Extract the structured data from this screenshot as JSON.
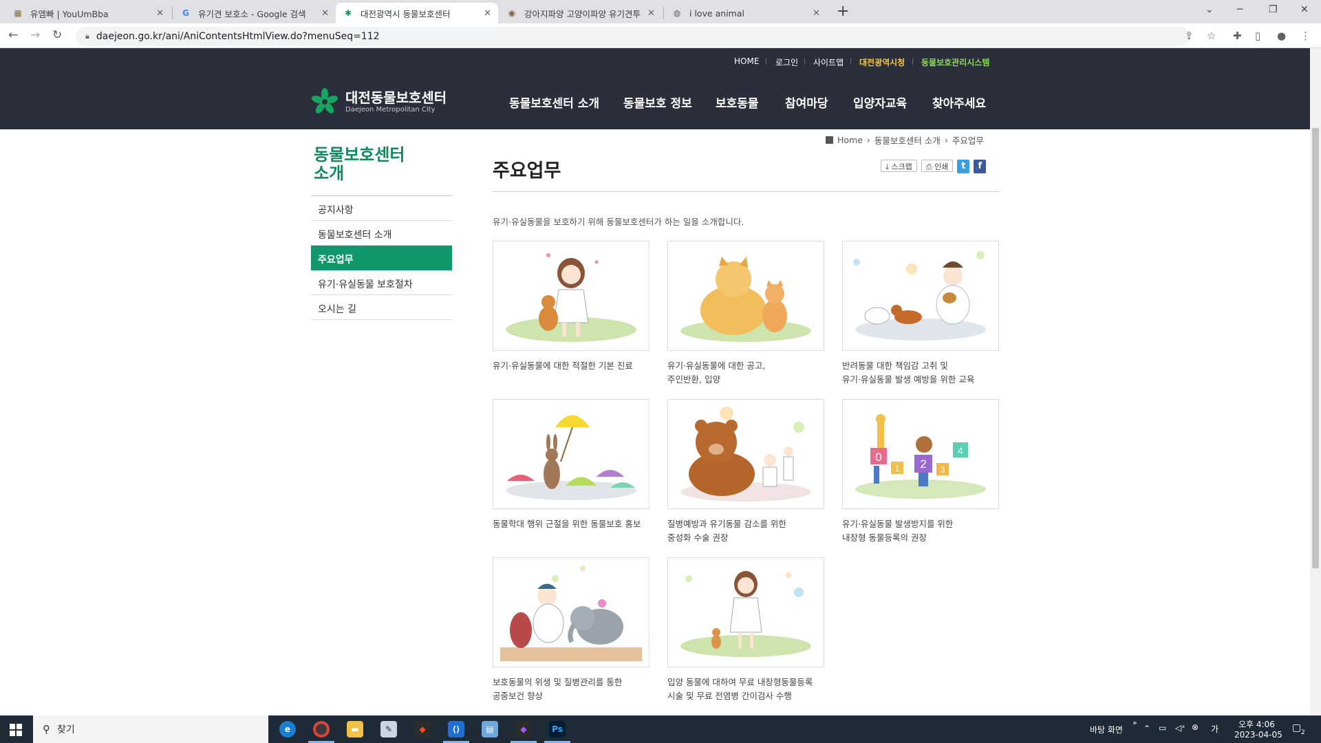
{
  "browser": {
    "tabs": [
      {
        "title": "유엠빠 | YouUmBba",
        "icon": "youumbba-icon"
      },
      {
        "title": "유기견 보호소 - Google 검색",
        "icon": "google-icon"
      },
      {
        "title": "대전광역시 동물보호센터",
        "icon": "daejeon-icon"
      },
      {
        "title": "강아지파양 고양이파양 유기견투",
        "icon": "dog-photo-icon"
      },
      {
        "title": "i love animal",
        "icon": "globe-icon"
      }
    ],
    "url": "daejeon.go.kr/ani/AniContentsHtmlView.do?menuSeq=112"
  },
  "site": {
    "top_links": [
      "HOME",
      "로그인",
      "사이트맵",
      "대전광역시청",
      "동물보호관리시스템"
    ],
    "logo_title": "대전동물보호센터",
    "logo_sub": "Daejeon Metropolitan City",
    "menu": [
      "동물보호센터 소개",
      "동물보호 정보",
      "보호동물",
      "참여마당",
      "입양자교육",
      "찾아주세요"
    ],
    "accent_color": "#11976a",
    "header_color": "#2b2f3c"
  },
  "breadcrumb": {
    "home": "Home",
    "sep": "›",
    "level1": "동물보호센터 소개",
    "level2": "주요업무"
  },
  "sidebar": {
    "title": "동물보호센터\n소개",
    "items": [
      {
        "label": "공지사항",
        "active": false
      },
      {
        "label": "동물보호센터 소개",
        "active": false
      },
      {
        "label": "주요업무",
        "active": true
      },
      {
        "label": "유기·유실동물 보호절차",
        "active": false
      },
      {
        "label": "오시는 길",
        "active": false
      }
    ]
  },
  "content": {
    "title": "주요업무",
    "tools": {
      "scrap": "스크랩",
      "print": "인쇄",
      "twitter": "t",
      "facebook": "f"
    },
    "intro": "유기·유실동물을 보호하기 위해 동물보호센터가 하는 일을 소개합니다.",
    "cards": [
      "유기·유실동물에 대한 적절한 기본 진료",
      "유기·유실동물에 대한 공고,\n주인반환, 입양",
      "반려동물 대한 책임감 고취 및\n유기·유실동물 발생 예방을 위한 교육",
      "동물학대 행위 근절을 위한 동물보호 홍보",
      "질병예방과 유기동물 감소를 위한\n중성화 수술 권장",
      "유기·유실동물 발생방지를 위한\n내장형 동물등록의 권장",
      "보호동물의 위생 및 질병관리를 통한\n공중보건 향상",
      "입양 동물에 대하여 무료 내장형동물등록\n시술 및 무료 전염병 간이검사 수행"
    ],
    "card6_numbers": [
      "0",
      "1",
      "2",
      "3",
      "4"
    ]
  },
  "taskbar": {
    "search_placeholder": "찾기",
    "desktop_label": "바탕 화면",
    "ime": "가",
    "time": "오후 4:06",
    "date": "2023-04-05",
    "notify_count": "2"
  }
}
